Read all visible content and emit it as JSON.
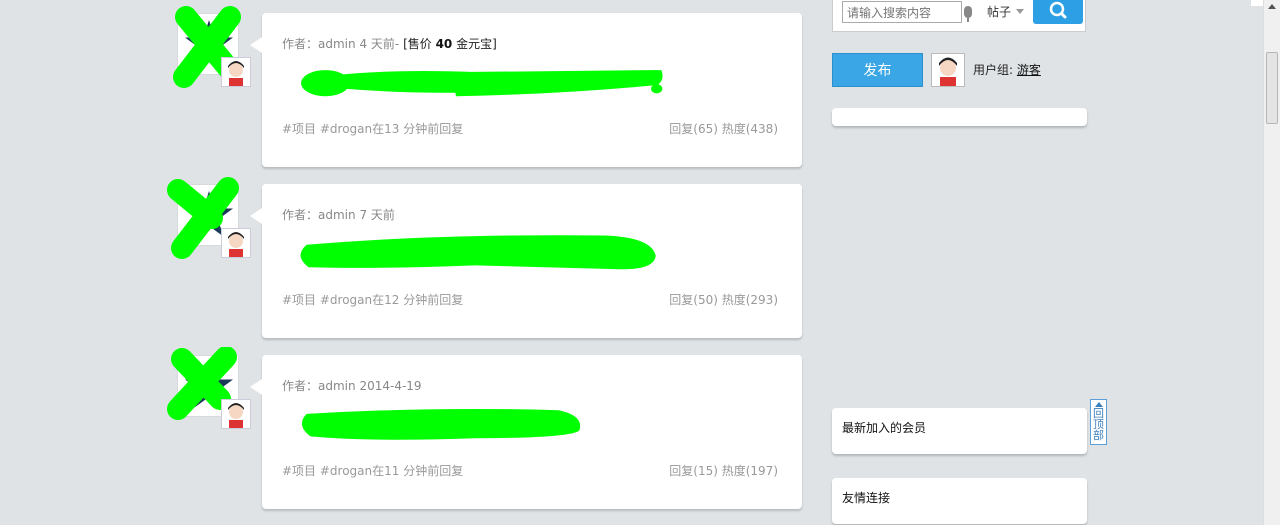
{
  "posts": [
    {
      "author_label": "作者：",
      "author": "admin",
      "time": "4 天前-",
      "price_prefix": "[售价",
      "price": "40",
      "price_suffix": "金元宝]",
      "tags": "#项目 #drogan在13 分钟前回复",
      "stats": "回复(65) 热度(438)"
    },
    {
      "author_label": "作者：",
      "author": "admin",
      "time": "7 天前",
      "price_prefix": "",
      "price": "",
      "price_suffix": "",
      "tags": "#项目 #drogan在12 分钟前回复",
      "stats": "回复(50) 热度(293)"
    },
    {
      "author_label": "作者：",
      "author": "admin",
      "time": "2014-4-19",
      "price_prefix": "",
      "price": "",
      "price_suffix": "",
      "tags": "#项目 #drogan在11 分钟前回复",
      "stats": "回复(15) 热度(197)"
    }
  ],
  "search": {
    "placeholder": "请输入搜索内容",
    "scope": "帖子"
  },
  "sidebar": {
    "publish_label": "发布",
    "usergroup_label": "用户组:",
    "usergroup_value": "游客",
    "panel_new_members": "最新加入的会员",
    "panel_friend_links": "友情连接"
  },
  "backtop_label": "回顶部",
  "colors": {
    "accent": "#2d9fe5",
    "background": "#dfe3e6",
    "redaction": "#00ff00"
  }
}
